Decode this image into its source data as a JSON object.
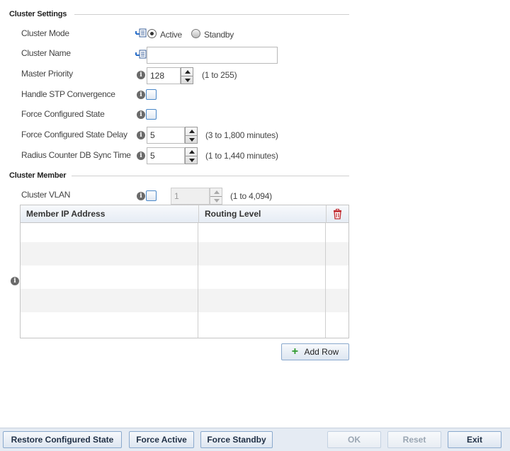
{
  "cluster_settings": {
    "title": "Cluster Settings",
    "mode_label": "Cluster Mode",
    "mode_options": [
      "Active",
      "Standby"
    ],
    "mode_selected": "Active",
    "name_label": "Cluster Name",
    "name_value": "",
    "priority_label": "Master Priority",
    "priority_value": "128",
    "priority_range": "(1 to 255)",
    "stp_label": "Handle STP Convergence",
    "stp_checked": false,
    "force_state_label": "Force Configured State",
    "force_state_checked": false,
    "force_delay_label": "Force Configured State Delay",
    "force_delay_value": "5",
    "force_delay_range": "(3 to 1,800 minutes)",
    "radius_label": "Radius Counter DB Sync Time",
    "radius_value": "5",
    "radius_range": "(1 to 1,440 minutes)"
  },
  "cluster_member": {
    "title": "Cluster Member",
    "vlan_label": "Cluster VLAN",
    "vlan_checked": false,
    "vlan_value": "1",
    "vlan_range": "(1 to 4,094)",
    "table": {
      "columns": [
        "Member IP Address",
        "Routing Level"
      ],
      "rows": []
    },
    "add_row_label": "Add Row"
  },
  "footer": {
    "restore_label": "Restore Configured State",
    "force_active_label": "Force Active",
    "force_standby_label": "Force Standby",
    "ok_label": "OK",
    "reset_label": "Reset",
    "exit_label": "Exit"
  },
  "icons": {
    "info": "info-icon",
    "inherit": "inherit-arrow-icon",
    "delete": "trash-icon",
    "add": "plus-icon"
  },
  "colors": {
    "accent_border": "#4a87c8",
    "delete_icon": "#c0282d",
    "add_icon": "#2f9a2f",
    "footer_bg": "#e5ebf3"
  }
}
